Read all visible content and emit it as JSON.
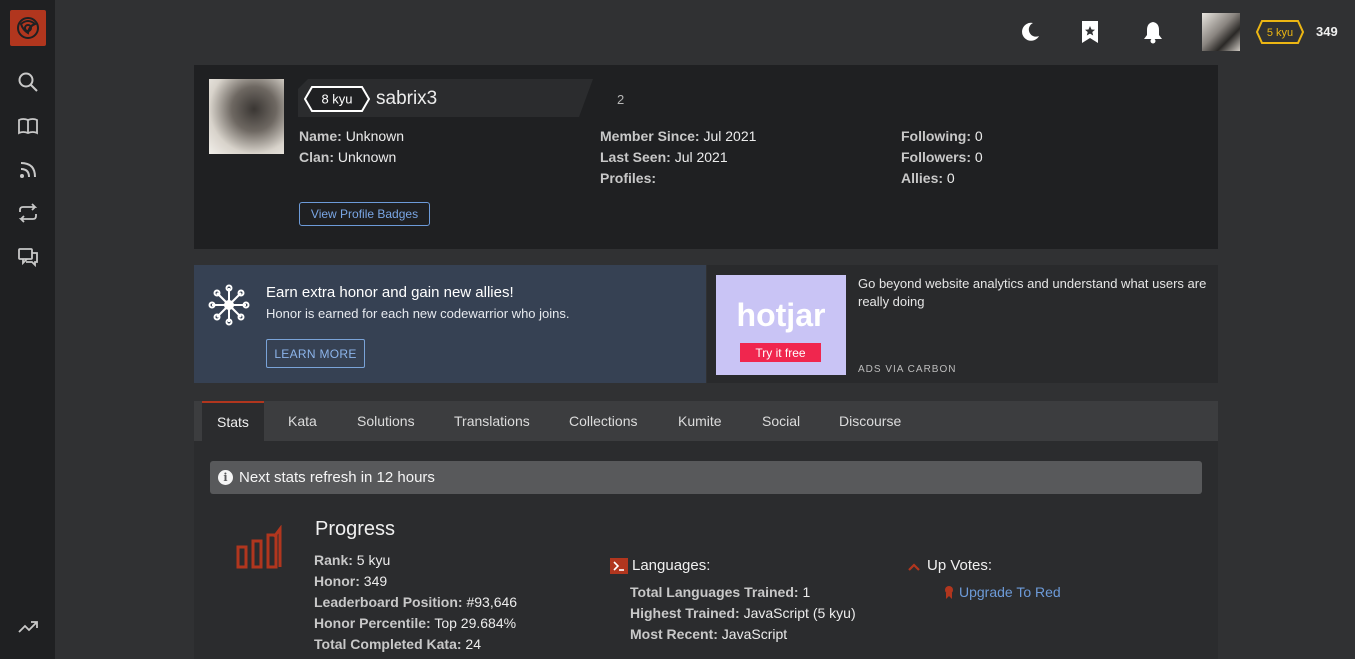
{
  "topbar": {
    "rank": "5 kyu",
    "honor": "349"
  },
  "profile": {
    "rank": "8 kyu",
    "username": "sabrix3",
    "honor": "2",
    "col1": [
      {
        "label": "Name:",
        "value": "Unknown"
      },
      {
        "label": "Clan:",
        "value": "Unknown"
      }
    ],
    "col2": [
      {
        "label": "Member Since:",
        "value": "Jul 2021"
      },
      {
        "label": "Last Seen:",
        "value": "Jul 2021"
      },
      {
        "label": "Profiles:",
        "value": ""
      }
    ],
    "col3": [
      {
        "label": "Following:",
        "value": "0"
      },
      {
        "label": "Followers:",
        "value": "0"
      },
      {
        "label": "Allies:",
        "value": "0"
      }
    ],
    "badges_button": "View Profile Badges"
  },
  "invite": {
    "title": "Earn extra honor and gain new allies!",
    "subtitle": "Honor is earned for each new codewarrior who joins.",
    "button": "LEARN MORE"
  },
  "ad": {
    "brand": "hotjar",
    "cta": "Try it free",
    "text": "Go beyond website analytics and understand what users are really doing",
    "via": "ADS VIA CARBON"
  },
  "tabs": [
    "Stats",
    "Kata",
    "Solutions",
    "Translations",
    "Collections",
    "Kumite",
    "Social",
    "Discourse"
  ],
  "notice": "Next stats refresh in 12 hours",
  "progress": {
    "title": "Progress",
    "rows": [
      {
        "label": "Rank:",
        "value": "5 kyu"
      },
      {
        "label": "Honor:",
        "value": "349"
      },
      {
        "label": "Leaderboard Position:",
        "value": "#93,646"
      },
      {
        "label": "Honor Percentile:",
        "value": "Top 29.684%"
      },
      {
        "label": "Total Completed Kata:",
        "value": "24"
      }
    ]
  },
  "languages": {
    "title": "Languages:",
    "rows": [
      {
        "label": "Total Languages Trained:",
        "value": "1"
      },
      {
        "label": "Highest Trained:",
        "value": "JavaScript (5 kyu)"
      },
      {
        "label": "Most Recent:",
        "value": "JavaScript"
      }
    ]
  },
  "upvotes": {
    "title": "Up Votes:",
    "link": "Upgrade To Red"
  },
  "colors": {
    "accent": "#b1361e",
    "rank_badge": "#ecb613",
    "link": "#6d9bd9",
    "invite_bg": "#364153",
    "ad_try": "#f0264e"
  }
}
